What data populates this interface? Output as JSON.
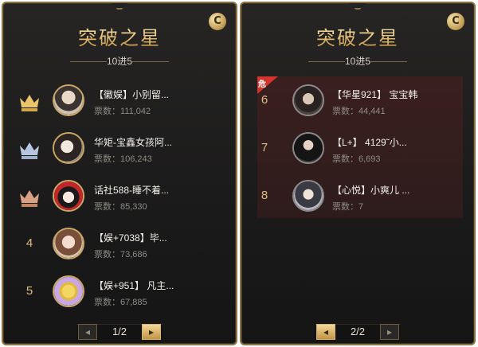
{
  "left_panel": {
    "title": "突破之星",
    "subtitle": "10进5",
    "coin_icon": "C",
    "items": [
      {
        "rank": "",
        "badge": "gold-crown",
        "name": "【徽娱】小别留...",
        "votes": "票数：111,042"
      },
      {
        "rank": "",
        "badge": "silver-crown",
        "name": "华矩-宝鑫女孩阿...",
        "votes": "票数：106,243"
      },
      {
        "rank": "",
        "badge": "bronze-crown",
        "name": "话社588-睡不着...",
        "votes": "票数：85,330"
      },
      {
        "rank": "4",
        "badge": "",
        "name": "【娱+7038】毕...",
        "votes": "票数：73,686"
      },
      {
        "rank": "5",
        "badge": "",
        "name": "【娱+951】 凡主...",
        "votes": "票数：67,885"
      }
    ],
    "pager": {
      "prev": "◂",
      "label": "1/2",
      "next": "▸"
    }
  },
  "right_panel": {
    "title": "突破之星",
    "subtitle": "10进5",
    "coin_icon": "C",
    "danger_label": "危",
    "items": [
      {
        "rank": "6",
        "name": "【华星921】 宝宝韩",
        "votes": "票数：44,441"
      },
      {
        "rank": "7",
        "name": "【L+】 4129˜小...",
        "votes": "票数：6,693"
      },
      {
        "rank": "8",
        "name": "【心悦】小爽儿 ...",
        "votes": "票数：7"
      }
    ],
    "pager": {
      "prev": "◂",
      "label": "2/2",
      "next": "▸"
    }
  },
  "colors": {
    "gold": "#e7c47a",
    "panel_bg": "#1e1d1c",
    "border": "#8a7246",
    "danger_bg": "#3a1f1f",
    "danger_tag": "#d0342c"
  }
}
